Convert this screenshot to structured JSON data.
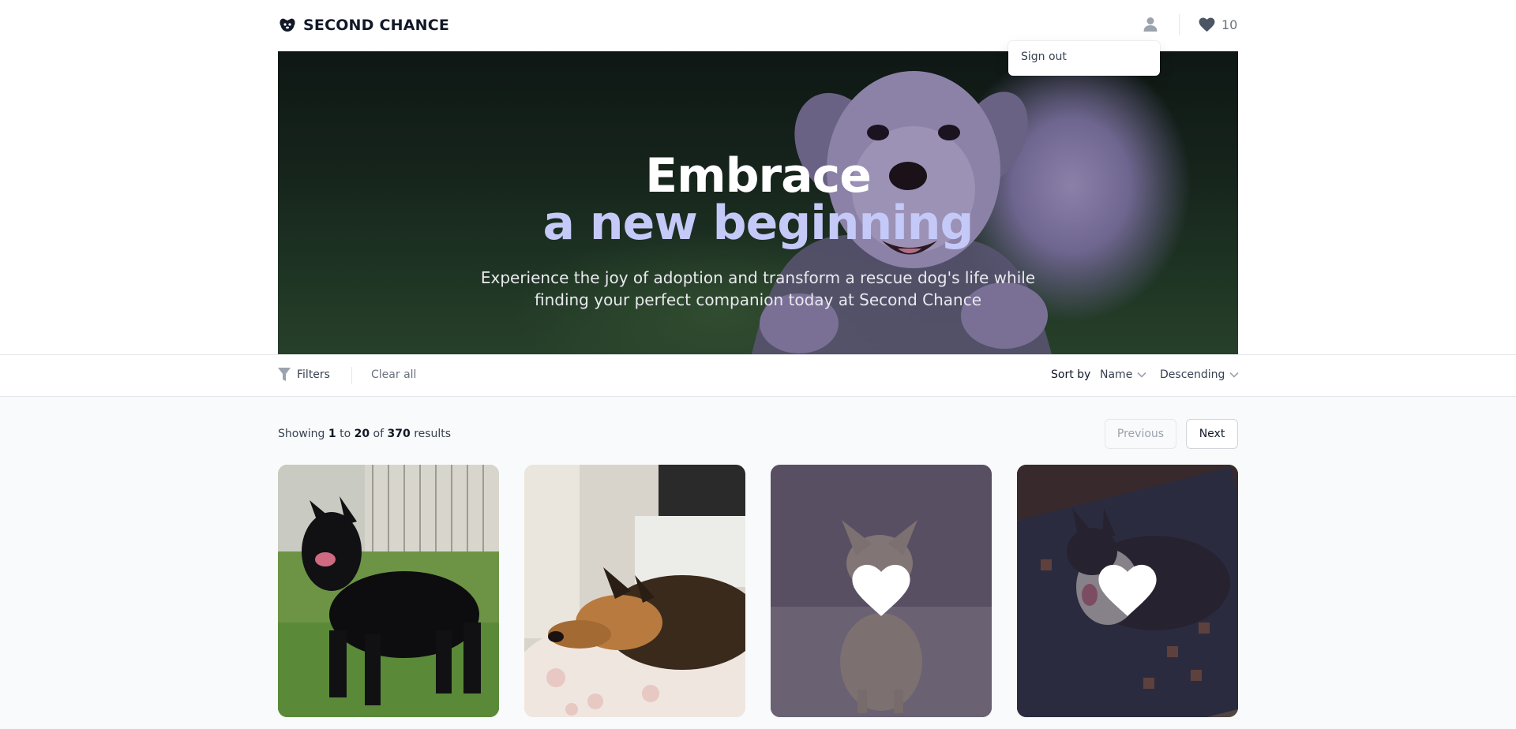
{
  "header": {
    "brand_name": "SECOND CHANCE",
    "favorites_count": "10",
    "user_menu": {
      "sign_out_label": "Sign out"
    }
  },
  "hero": {
    "title_line1": "Embrace",
    "title_line2": "a new beginning",
    "subtitle": "Experience the joy of adoption and transform a rescue dog's life while finding your perfect companion today at Second Chance"
  },
  "filters": {
    "filters_label": "Filters",
    "clear_all_label": "Clear all",
    "sort_by_label": "Sort by",
    "sort_field": "Name",
    "sort_order": "Descending"
  },
  "results": {
    "prefix": "Showing",
    "from": "1",
    "to_word": "to",
    "to": "20",
    "of_word": "of",
    "total": "370",
    "suffix": "results"
  },
  "pagination": {
    "previous_label": "Previous",
    "next_label": "Next"
  },
  "cards": [
    {
      "favorited": false
    },
    {
      "favorited": false
    },
    {
      "favorited": true
    },
    {
      "favorited": true
    }
  ],
  "colors": {
    "hero_accent": "#c4c9f8",
    "page_background": "#f9fafb",
    "favorite_overlay": "#32283c"
  },
  "icons": [
    "paw-icon",
    "user-icon",
    "heart-icon",
    "funnel-icon",
    "chevron-down-icon"
  ]
}
